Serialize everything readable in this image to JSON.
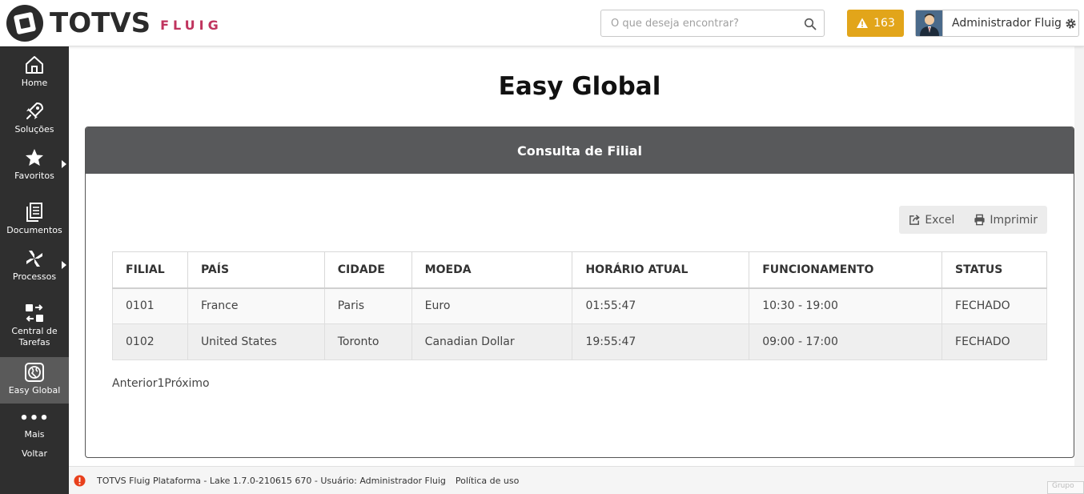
{
  "header": {
    "logo_text": "TOTVS",
    "logo_sub": "FLUIG",
    "search_placeholder": "O que deseja encontrar?",
    "alert_count": "163",
    "user_name": "Administrador Fluig",
    "colors": {
      "alert": "#e2a51a",
      "brand_sub": "#c0345e"
    }
  },
  "sidebar": {
    "items": [
      {
        "label": "Home",
        "icon": "home-icon"
      },
      {
        "label": "Soluções",
        "icon": "rocket-icon"
      },
      {
        "label": "Favoritos",
        "icon": "star-icon"
      },
      {
        "label": "Documentos",
        "icon": "documents-icon"
      },
      {
        "label": "Processos",
        "icon": "processes-icon"
      },
      {
        "label": "Central de Tarefas",
        "icon": "tasks-icon"
      },
      {
        "label": "Easy Global",
        "icon": "globe-icon",
        "active": true
      },
      {
        "label": "Mais",
        "icon": "more-icon"
      },
      {
        "label": "Voltar",
        "icon": ""
      }
    ]
  },
  "main": {
    "title": "Easy Global",
    "panel_title": "Consulta de Filial",
    "toolbar": {
      "excel": "Excel",
      "print": "Imprimir"
    },
    "table": {
      "columns": [
        "FILIAL",
        "PAÍS",
        "CIDADE",
        "MOEDA",
        "HORÁRIO ATUAL",
        "FUNCIONAMENTO",
        "STATUS"
      ],
      "rows": [
        [
          "0101",
          "France",
          "Paris",
          "Euro",
          "01:55:47",
          "10:30 - 19:00",
          "FECHADO"
        ],
        [
          "0102",
          "United States",
          "Toronto",
          "Canadian Dollar",
          "19:55:47",
          "09:00 - 17:00",
          "FECHADO"
        ]
      ]
    },
    "pager": "Anterior1Próximo"
  },
  "footer": {
    "info": "TOTVS Fluig Plataforma - Lake 1.7.0-210615 670 - Usuário: Administrador Fluig",
    "policy": "Política de uso",
    "corner": "Grupo"
  }
}
